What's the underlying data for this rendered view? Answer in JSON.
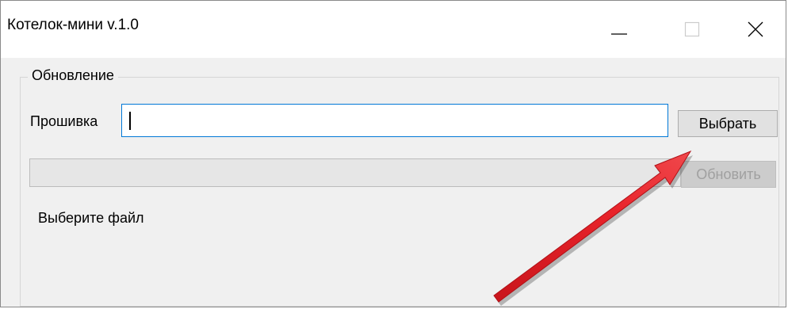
{
  "window": {
    "title": "Котелок-мини v.1.0",
    "controls": {
      "minimize_icon": "minimize-icon",
      "maximize_icon": "maximize-icon",
      "close_icon": "close-icon"
    }
  },
  "update_group": {
    "legend": "Обновление",
    "firmware": {
      "label": "Прошивка",
      "value": "",
      "browse_label": "Выбрать"
    },
    "progress": {
      "value": 0
    },
    "update_label": "Обновить",
    "status": "Выберите файл"
  },
  "annotation": {
    "arrow_color": "#e8232a",
    "arrow_icon": "annotation-arrow"
  }
}
